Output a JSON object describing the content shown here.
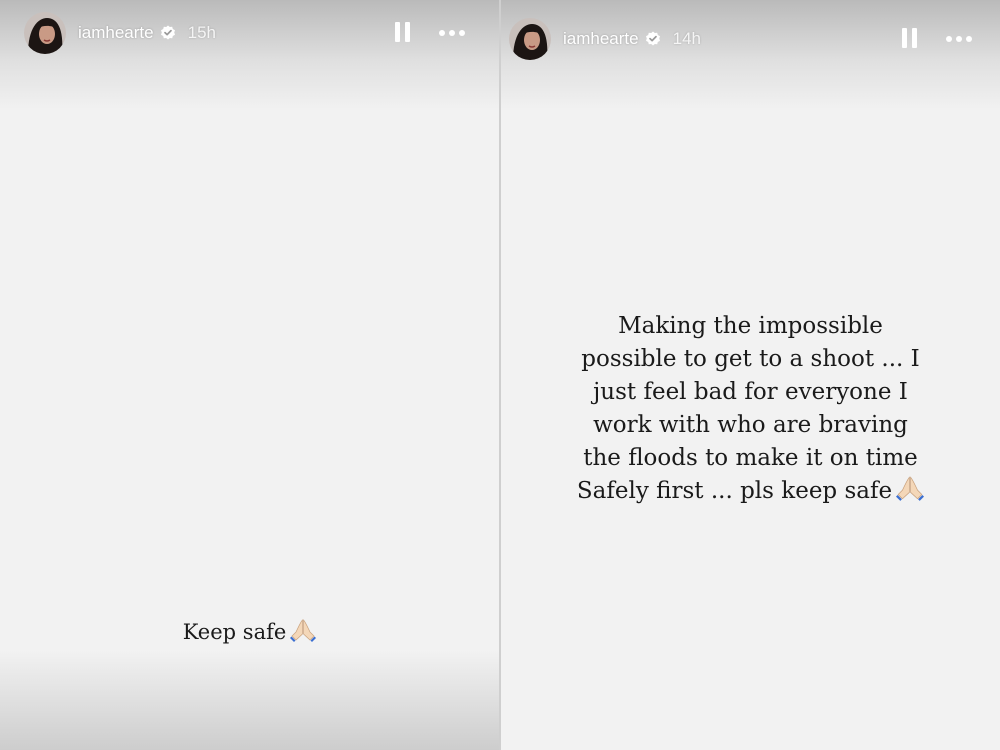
{
  "stories": [
    {
      "username": "iamhearte",
      "time": "15h",
      "caption_lines": [
        "Keep safe"
      ],
      "caption_emoji": "praying-hands-icon"
    },
    {
      "username": "iamhearte",
      "time": "14h",
      "caption_lines": [
        "Making the impossible",
        "possible to get to a shoot ... I",
        "just feel bad for everyone I",
        "work with who are braving",
        "the floods to make it on time",
        "Safely first ... pls keep safe"
      ],
      "caption_emoji": "praying-hands-icon"
    }
  ],
  "colors": {
    "background": "#f2f2f2",
    "header_text": "#ffffff",
    "caption_text": "#1a1a1a"
  }
}
